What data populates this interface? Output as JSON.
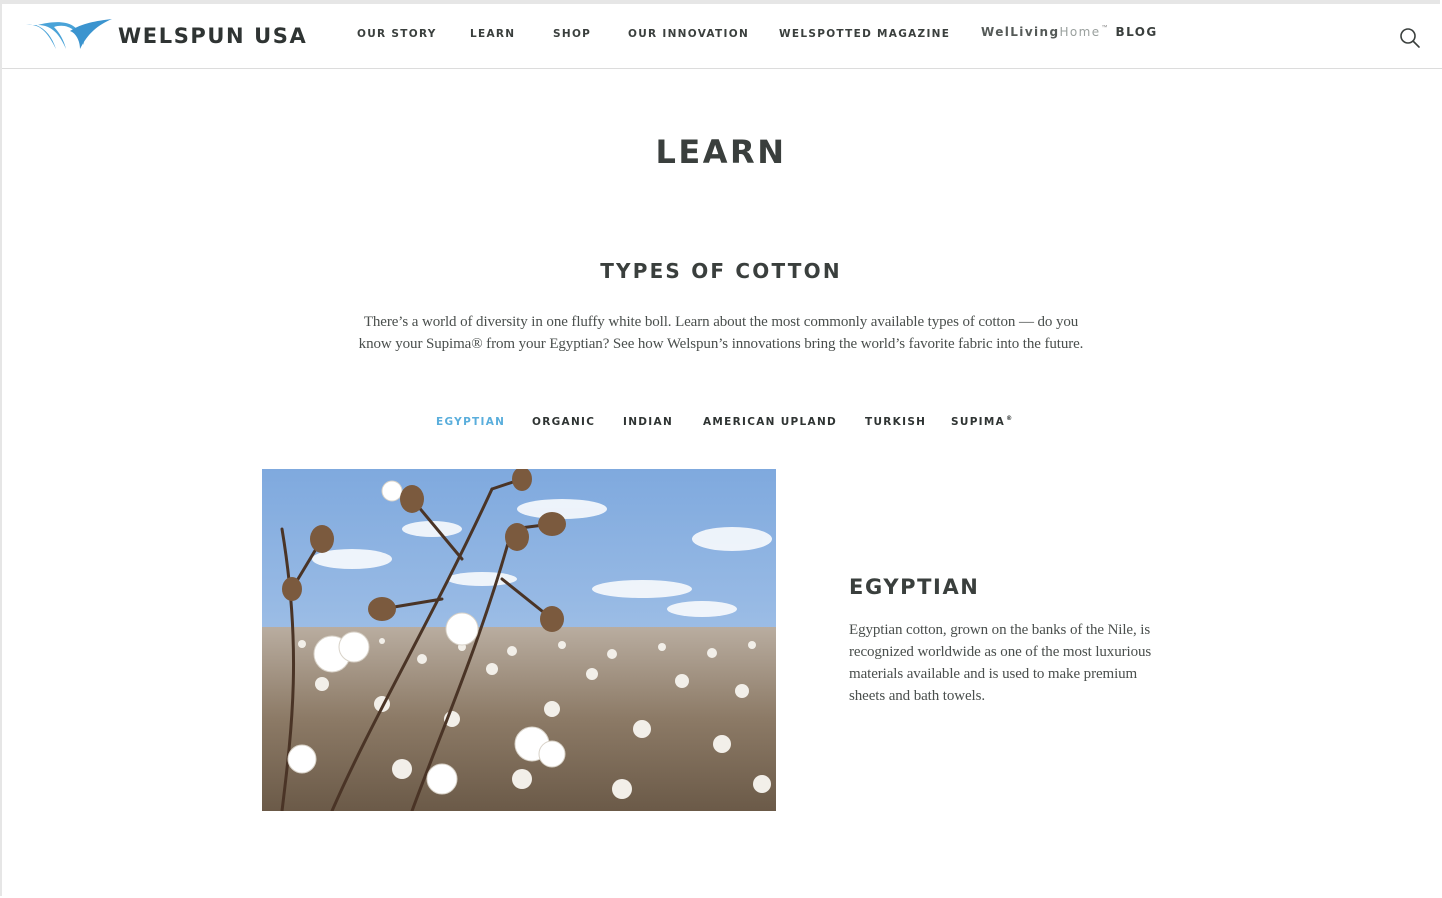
{
  "brand": {
    "name": "WELSPUN USA",
    "accent": "#4aa3d8"
  },
  "nav": {
    "items": [
      {
        "label": "OUR STORY"
      },
      {
        "label": "LEARN"
      },
      {
        "label": "SHOP"
      },
      {
        "label": "OUR INNOVATION"
      },
      {
        "label": "WELSPOTTED MAGAZINE"
      }
    ],
    "blog": {
      "brand_wel": "WelLiving",
      "brand_home": "Home",
      "trademark": "™",
      "label": "BLOG"
    },
    "search_icon": "search-icon"
  },
  "page": {
    "title": "LEARN"
  },
  "section": {
    "title": "TYPES OF COTTON",
    "intro": "There’s a world of diversity in one fluffy white boll. Learn about the most commonly available types of cotton — do you know your Supima® from your Egyptian? See how Welspun’s innovations bring the world’s favorite fabric into the future."
  },
  "tabs": {
    "active_color": "#5aaedc",
    "items": [
      {
        "label": "EGYPTIAN",
        "active": true
      },
      {
        "label": "ORGANIC",
        "active": false
      },
      {
        "label": "INDIAN",
        "active": false
      },
      {
        "label": "AMERICAN UPLAND",
        "active": false
      },
      {
        "label": "TURKISH",
        "active": false
      },
      {
        "label": "SUPIMA",
        "mark": "®",
        "active": false
      }
    ]
  },
  "detail": {
    "title": "EGYPTIAN",
    "text": "Egyptian cotton, grown on the banks of the Nile, is recognized worldwide as one of the most luxurious materials available and is used to make premium sheets and bath towels."
  }
}
